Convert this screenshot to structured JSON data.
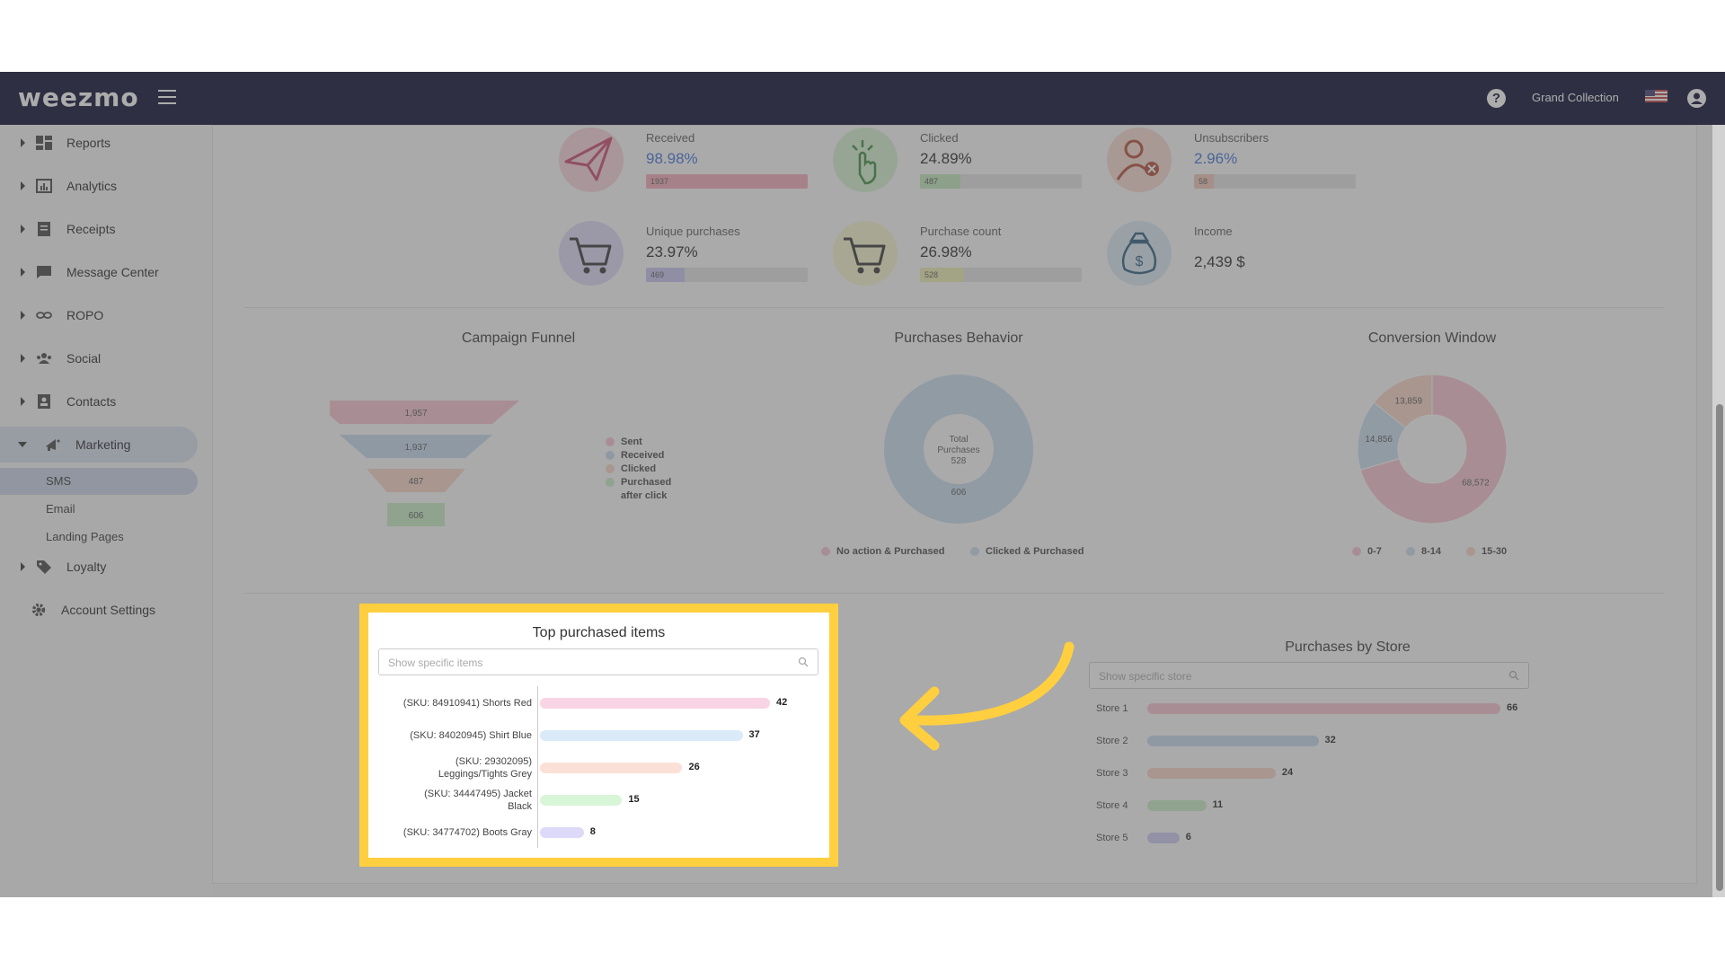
{
  "header": {
    "logo_text": "weezmo",
    "store_name": "Grand Collection"
  },
  "sidebar": {
    "items": [
      {
        "label": "Reports",
        "icon": "dashboard-icon"
      },
      {
        "label": "Analytics",
        "icon": "analytics-icon"
      },
      {
        "label": "Receipts",
        "icon": "receipt-icon"
      },
      {
        "label": "Message Center",
        "icon": "message-icon"
      },
      {
        "label": "ROPO",
        "icon": "infinity-icon"
      },
      {
        "label": "Social",
        "icon": "people-icon"
      },
      {
        "label": "Contacts",
        "icon": "contacts-icon"
      },
      {
        "label": "Marketing",
        "icon": "megaphone-icon"
      }
    ],
    "marketing_sub": [
      "SMS",
      "Email",
      "Landing Pages"
    ],
    "loyalty_label": "Loyalty",
    "account_settings_label": "Account Settings"
  },
  "kpis": [
    {
      "label": "Received",
      "value": "98.98%",
      "bar_text": "1937",
      "fill": 1.0,
      "color": "#f4a8bb",
      "circle": "#f7d2dc",
      "icon": "paper-plane-icon",
      "blue": true
    },
    {
      "label": "Clicked",
      "value": "24.89%",
      "bar_text": "487",
      "fill": 0.25,
      "color": "#bfe7bb",
      "circle": "#d4f0d1",
      "icon": "pointer-click-icon",
      "blue": false
    },
    {
      "label": "Unsubscribers",
      "value": "2.96%",
      "bar_text": "58",
      "fill": 0.03,
      "color": "#f0c4b8",
      "circle": "#f7d9d0",
      "icon": "user-remove-icon",
      "blue": true
    },
    {
      "label": "Unique purchases",
      "value": "23.97%",
      "bar_text": "469",
      "fill": 0.24,
      "color": "#c7c2f1",
      "circle": "#dcd8f7",
      "icon": "cart-icon",
      "blue": false
    },
    {
      "label": "Purchase count",
      "value": "26.98%",
      "bar_text": "528",
      "fill": 0.27,
      "color": "#ecedb0",
      "circle": "#f4f4cc",
      "icon": "cart-icon",
      "blue": false
    },
    {
      "label": "Income",
      "value": "2,439 $",
      "bar_text": "",
      "fill": 0,
      "color": "#cfe4f2",
      "circle": "#d8e9f4",
      "icon": "money-bag-icon",
      "blue": false
    }
  ],
  "funnel": {
    "title": "Campaign Funnel",
    "chart_data": {
      "type": "bar",
      "categories": [
        "Sent",
        "Received",
        "Clicked",
        "Purchased after click"
      ],
      "values": [
        1957,
        1937,
        487,
        606
      ],
      "labels": [
        "1,957",
        "1,937",
        "487",
        "606"
      ],
      "colors": [
        "#f7c2cf",
        "#c4d9ef",
        "#f7d2c4",
        "#c6edc3"
      ]
    },
    "legend": [
      "Sent",
      "Received",
      "Clicked",
      "Purchased",
      "after click"
    ]
  },
  "purchases_behavior": {
    "title": "Purchases Behavior",
    "center_lines": [
      "Total",
      "Purchases",
      "528"
    ],
    "slice_label": "606",
    "legend": [
      "No action & Purchased",
      "Clicked & Purchased"
    ],
    "colors": [
      "#f7c2cf",
      "#c8dcee"
    ]
  },
  "conversion_window": {
    "title": "Conversion Window",
    "chart_data": {
      "type": "pie",
      "categories": [
        "0-7",
        "8-14",
        "15-30"
      ],
      "values": [
        68572,
        14856,
        13859
      ],
      "labels": [
        "68,572",
        "14,856",
        "13,859"
      ],
      "colors": [
        "#f7c2cf",
        "#c8dcee",
        "#f7d2c4"
      ]
    }
  },
  "top_items": {
    "title": "Top purchased items",
    "search_placeholder": "Show specific items",
    "chart_data": {
      "type": "bar",
      "categories": [
        [
          "(SKU: 84910941) Shorts Red"
        ],
        [
          "(SKU: 84020945) Shirt Blue"
        ],
        [
          "(SKU: 29302095)",
          "Leggings/Tights Grey"
        ],
        [
          "(SKU: 34447495) Jacket",
          "Black"
        ],
        [
          "(SKU: 34774702) Boots Gray"
        ]
      ],
      "values": [
        42,
        37,
        26,
        15,
        8
      ],
      "colors": [
        "#f9d4e4",
        "#dbeaf8",
        "#fbe0d7",
        "#d9f5d8",
        "#dcdaf8"
      ]
    }
  },
  "by_store": {
    "title": "Purchases by Store",
    "search_placeholder": "Show specific store",
    "chart_data": {
      "type": "bar",
      "categories": [
        "Store 1",
        "Store 2",
        "Store 3",
        "Store 4",
        "Store 5"
      ],
      "values": [
        66,
        32,
        24,
        11,
        6
      ],
      "colors": [
        "#f7c2cf",
        "#c4d9ef",
        "#f7d2c4",
        "#c6edc3",
        "#cdc8f0"
      ]
    }
  }
}
